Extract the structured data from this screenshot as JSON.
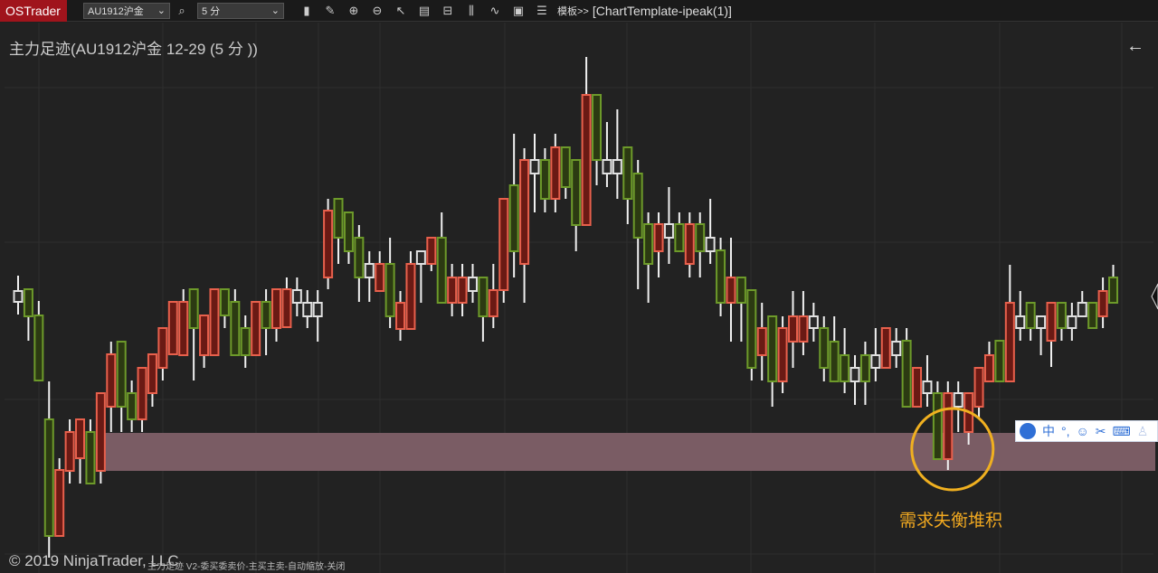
{
  "toolbar": {
    "brand": "OSTrader",
    "instrument": "AU1912沪金",
    "interval": "5 分",
    "template_button": "模板>>",
    "template_name": "[ChartTemplate-ipeak(1)]",
    "icons": [
      "bar-chart-icon",
      "pencil-icon",
      "zoom-in-icon",
      "zoom-out-icon",
      "cursor-icon",
      "properties-icon",
      "data-box-icon",
      "indicators-icon",
      "strategy-icon",
      "calculator-icon",
      "list-icon"
    ]
  },
  "chart": {
    "title": "主力足迹(AU1912沪金 12-29 (5 分 ))",
    "copyright": "© 2019 NinjaTrader, LLC",
    "indicator_label": "主力足迹 V2-委买委卖价-主买主卖-自动缩放-关闭",
    "annotation": "需求失衡堆积",
    "colors": {
      "up": "#e8604c",
      "down": "#6d9a2a",
      "flat": "#e0e0e0",
      "zone": "#7a5c64",
      "circle": "#f0b020"
    }
  },
  "ime": {
    "mode": "中",
    "punct": "°,"
  },
  "chart_data": {
    "type": "candlestick",
    "ylim": [
      0,
      600
    ],
    "zone": [
      119,
      161
    ],
    "zone_start_index": 8,
    "highlight_index": 90,
    "candles": [
      [
        306,
        335,
        292,
        318,
        "w"
      ],
      [
        320,
        320,
        263,
        290,
        "g"
      ],
      [
        291,
        307,
        219,
        219,
        "g"
      ],
      [
        176,
        218,
        23,
        47,
        "g"
      ],
      [
        47,
        133,
        47,
        120,
        "r"
      ],
      [
        119,
        176,
        105,
        162,
        "r"
      ],
      [
        133,
        176,
        105,
        176,
        "r"
      ],
      [
        162,
        176,
        105,
        105,
        "g"
      ],
      [
        119,
        205,
        105,
        205,
        "r"
      ],
      [
        190,
        262,
        162,
        248,
        "r"
      ],
      [
        262,
        262,
        162,
        190,
        "g"
      ],
      [
        205,
        219,
        162,
        176,
        "g"
      ],
      [
        176,
        233,
        162,
        233,
        "r"
      ],
      [
        205,
        248,
        190,
        248,
        "r"
      ],
      [
        233,
        277,
        219,
        277,
        "r"
      ],
      [
        248,
        306,
        248,
        306,
        "r"
      ],
      [
        247,
        320,
        247,
        306,
        "r"
      ],
      [
        320,
        320,
        219,
        277,
        "g"
      ],
      [
        247,
        291,
        233,
        291,
        "r"
      ],
      [
        247,
        320,
        247,
        320,
        "r"
      ],
      [
        320,
        320,
        277,
        291,
        "g"
      ],
      [
        306,
        320,
        247,
        247,
        "g"
      ],
      [
        277,
        291,
        233,
        247,
        "g"
      ],
      [
        247,
        306,
        247,
        306,
        "r"
      ],
      [
        306,
        320,
        247,
        277,
        "g"
      ],
      [
        277,
        320,
        262,
        320,
        "r"
      ],
      [
        278,
        333,
        277,
        320,
        "r"
      ],
      [
        305,
        333,
        290,
        319,
        "w"
      ],
      [
        290,
        319,
        277,
        305,
        "w"
      ],
      [
        290,
        319,
        262,
        305,
        "w"
      ],
      [
        333,
        420,
        320,
        407,
        "r"
      ],
      [
        420,
        420,
        348,
        377,
        "g"
      ],
      [
        405,
        405,
        348,
        362,
        "g"
      ],
      [
        377,
        391,
        306,
        333,
        "g"
      ],
      [
        333,
        362,
        306,
        348,
        "w"
      ],
      [
        318,
        362,
        318,
        348,
        "r"
      ],
      [
        348,
        377,
        277,
        290,
        "g"
      ],
      [
        276,
        318,
        263,
        305,
        "r"
      ],
      [
        276,
        362,
        276,
        348,
        "r"
      ],
      [
        348,
        362,
        305,
        362,
        "w"
      ],
      [
        348,
        377,
        340,
        377,
        "r"
      ],
      [
        377,
        405,
        305,
        305,
        "g"
      ],
      [
        305,
        348,
        290,
        333,
        "r"
      ],
      [
        305,
        348,
        290,
        333,
        "r"
      ],
      [
        318,
        348,
        305,
        333,
        "w"
      ],
      [
        333,
        333,
        262,
        290,
        "g"
      ],
      [
        290,
        348,
        277,
        319,
        "r"
      ],
      [
        319,
        420,
        305,
        420,
        "r"
      ],
      [
        435,
        492,
        333,
        362,
        "g"
      ],
      [
        348,
        476,
        305,
        463,
        "r"
      ],
      [
        448,
        492,
        405,
        463,
        "w"
      ],
      [
        463,
        476,
        405,
        420,
        "g"
      ],
      [
        420,
        492,
        405,
        477,
        "r"
      ],
      [
        477,
        477,
        420,
        433,
        "g"
      ],
      [
        463,
        463,
        362,
        391,
        "g"
      ],
      [
        391,
        577,
        391,
        535,
        "r"
      ],
      [
        535,
        535,
        435,
        463,
        "g"
      ],
      [
        448,
        505,
        433,
        463,
        "w"
      ],
      [
        448,
        519,
        420,
        463,
        "w"
      ],
      [
        477,
        477,
        392,
        420,
        "g"
      ],
      [
        448,
        463,
        320,
        377,
        "g"
      ],
      [
        392,
        405,
        305,
        348,
        "g"
      ],
      [
        362,
        405,
        333,
        392,
        "r"
      ],
      [
        377,
        433,
        348,
        392,
        "w"
      ],
      [
        392,
        405,
        362,
        362,
        "g"
      ],
      [
        348,
        405,
        333,
        392,
        "r"
      ],
      [
        392,
        405,
        333,
        362,
        "g"
      ],
      [
        362,
        420,
        348,
        377,
        "w"
      ],
      [
        363,
        377,
        290,
        305,
        "g"
      ],
      [
        305,
        377,
        262,
        333,
        "r"
      ],
      [
        333,
        333,
        262,
        305,
        "g"
      ],
      [
        319,
        319,
        219,
        233,
        "g"
      ],
      [
        247,
        305,
        219,
        277,
        "r"
      ],
      [
        290,
        290,
        190,
        218,
        "g"
      ],
      [
        218,
        290,
        205,
        277,
        "r"
      ],
      [
        262,
        318,
        233,
        290,
        "r"
      ],
      [
        262,
        318,
        247,
        290,
        "r"
      ],
      [
        277,
        305,
        262,
        290,
        "w"
      ],
      [
        277,
        290,
        218,
        233,
        "g"
      ],
      [
        262,
        290,
        218,
        218,
        "g"
      ],
      [
        247,
        277,
        205,
        218,
        "g"
      ],
      [
        218,
        247,
        192,
        233,
        "w"
      ],
      [
        247,
        262,
        192,
        218,
        "g"
      ],
      [
        233,
        277,
        218,
        247,
        "w"
      ],
      [
        233,
        277,
        233,
        277,
        "r"
      ],
      [
        247,
        277,
        233,
        262,
        "w"
      ],
      [
        263,
        277,
        190,
        190,
        "g"
      ],
      [
        190,
        233,
        190,
        233,
        "r"
      ],
      [
        205,
        247,
        190,
        218,
        "w"
      ],
      [
        205,
        218,
        132,
        132,
        "g"
      ],
      [
        132,
        218,
        120,
        205,
        "r"
      ],
      [
        190,
        218,
        162,
        205,
        "w"
      ],
      [
        162,
        205,
        148,
        205,
        "r"
      ],
      [
        190,
        233,
        177,
        233,
        "r"
      ],
      [
        218,
        262,
        218,
        247,
        "r"
      ],
      [
        263,
        263,
        218,
        218,
        "g"
      ],
      [
        218,
        347,
        218,
        305,
        "r"
      ],
      [
        277,
        318,
        263,
        290,
        "w"
      ],
      [
        305,
        305,
        263,
        277,
        "g"
      ],
      [
        277,
        290,
        247,
        290,
        "w"
      ],
      [
        263,
        305,
        234,
        305,
        "r"
      ],
      [
        305,
        305,
        263,
        277,
        "g"
      ],
      [
        277,
        305,
        263,
        290,
        "w"
      ],
      [
        290,
        318,
        290,
        305,
        "w"
      ],
      [
        305,
        305,
        277,
        277,
        "g"
      ],
      [
        290,
        333,
        277,
        318,
        "r"
      ],
      [
        333,
        347,
        305,
        305,
        "g"
      ]
    ]
  }
}
